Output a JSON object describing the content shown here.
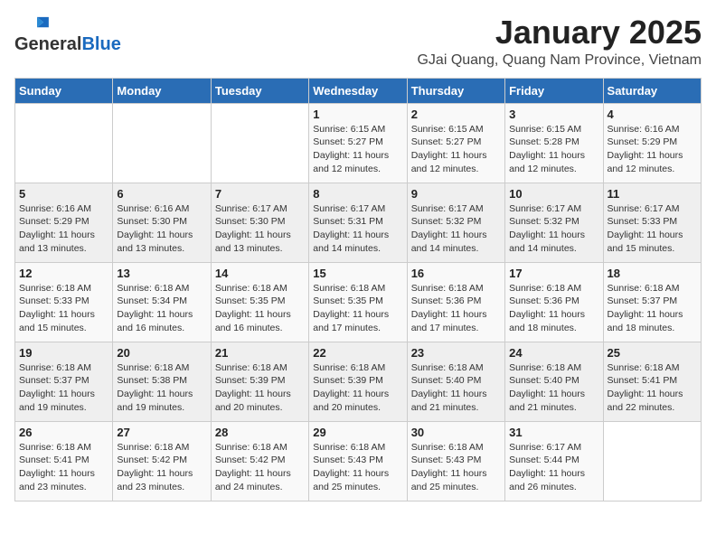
{
  "header": {
    "logo_general": "General",
    "logo_blue": "Blue",
    "month": "January 2025",
    "location": "GJai Quang, Quang Nam Province, Vietnam"
  },
  "weekdays": [
    "Sunday",
    "Monday",
    "Tuesday",
    "Wednesday",
    "Thursday",
    "Friday",
    "Saturday"
  ],
  "weeks": [
    [
      {
        "day": "",
        "info": ""
      },
      {
        "day": "",
        "info": ""
      },
      {
        "day": "",
        "info": ""
      },
      {
        "day": "1",
        "info": "Sunrise: 6:15 AM\nSunset: 5:27 PM\nDaylight: 11 hours and 12 minutes."
      },
      {
        "day": "2",
        "info": "Sunrise: 6:15 AM\nSunset: 5:27 PM\nDaylight: 11 hours and 12 minutes."
      },
      {
        "day": "3",
        "info": "Sunrise: 6:15 AM\nSunset: 5:28 PM\nDaylight: 11 hours and 12 minutes."
      },
      {
        "day": "4",
        "info": "Sunrise: 6:16 AM\nSunset: 5:29 PM\nDaylight: 11 hours and 12 minutes."
      }
    ],
    [
      {
        "day": "5",
        "info": "Sunrise: 6:16 AM\nSunset: 5:29 PM\nDaylight: 11 hours and 13 minutes."
      },
      {
        "day": "6",
        "info": "Sunrise: 6:16 AM\nSunset: 5:30 PM\nDaylight: 11 hours and 13 minutes."
      },
      {
        "day": "7",
        "info": "Sunrise: 6:17 AM\nSunset: 5:30 PM\nDaylight: 11 hours and 13 minutes."
      },
      {
        "day": "8",
        "info": "Sunrise: 6:17 AM\nSunset: 5:31 PM\nDaylight: 11 hours and 14 minutes."
      },
      {
        "day": "9",
        "info": "Sunrise: 6:17 AM\nSunset: 5:32 PM\nDaylight: 11 hours and 14 minutes."
      },
      {
        "day": "10",
        "info": "Sunrise: 6:17 AM\nSunset: 5:32 PM\nDaylight: 11 hours and 14 minutes."
      },
      {
        "day": "11",
        "info": "Sunrise: 6:17 AM\nSunset: 5:33 PM\nDaylight: 11 hours and 15 minutes."
      }
    ],
    [
      {
        "day": "12",
        "info": "Sunrise: 6:18 AM\nSunset: 5:33 PM\nDaylight: 11 hours and 15 minutes."
      },
      {
        "day": "13",
        "info": "Sunrise: 6:18 AM\nSunset: 5:34 PM\nDaylight: 11 hours and 16 minutes."
      },
      {
        "day": "14",
        "info": "Sunrise: 6:18 AM\nSunset: 5:35 PM\nDaylight: 11 hours and 16 minutes."
      },
      {
        "day": "15",
        "info": "Sunrise: 6:18 AM\nSunset: 5:35 PM\nDaylight: 11 hours and 17 minutes."
      },
      {
        "day": "16",
        "info": "Sunrise: 6:18 AM\nSunset: 5:36 PM\nDaylight: 11 hours and 17 minutes."
      },
      {
        "day": "17",
        "info": "Sunrise: 6:18 AM\nSunset: 5:36 PM\nDaylight: 11 hours and 18 minutes."
      },
      {
        "day": "18",
        "info": "Sunrise: 6:18 AM\nSunset: 5:37 PM\nDaylight: 11 hours and 18 minutes."
      }
    ],
    [
      {
        "day": "19",
        "info": "Sunrise: 6:18 AM\nSunset: 5:37 PM\nDaylight: 11 hours and 19 minutes."
      },
      {
        "day": "20",
        "info": "Sunrise: 6:18 AM\nSunset: 5:38 PM\nDaylight: 11 hours and 19 minutes."
      },
      {
        "day": "21",
        "info": "Sunrise: 6:18 AM\nSunset: 5:39 PM\nDaylight: 11 hours and 20 minutes."
      },
      {
        "day": "22",
        "info": "Sunrise: 6:18 AM\nSunset: 5:39 PM\nDaylight: 11 hours and 20 minutes."
      },
      {
        "day": "23",
        "info": "Sunrise: 6:18 AM\nSunset: 5:40 PM\nDaylight: 11 hours and 21 minutes."
      },
      {
        "day": "24",
        "info": "Sunrise: 6:18 AM\nSunset: 5:40 PM\nDaylight: 11 hours and 21 minutes."
      },
      {
        "day": "25",
        "info": "Sunrise: 6:18 AM\nSunset: 5:41 PM\nDaylight: 11 hours and 22 minutes."
      }
    ],
    [
      {
        "day": "26",
        "info": "Sunrise: 6:18 AM\nSunset: 5:41 PM\nDaylight: 11 hours and 23 minutes."
      },
      {
        "day": "27",
        "info": "Sunrise: 6:18 AM\nSunset: 5:42 PM\nDaylight: 11 hours and 23 minutes."
      },
      {
        "day": "28",
        "info": "Sunrise: 6:18 AM\nSunset: 5:42 PM\nDaylight: 11 hours and 24 minutes."
      },
      {
        "day": "29",
        "info": "Sunrise: 6:18 AM\nSunset: 5:43 PM\nDaylight: 11 hours and 25 minutes."
      },
      {
        "day": "30",
        "info": "Sunrise: 6:18 AM\nSunset: 5:43 PM\nDaylight: 11 hours and 25 minutes."
      },
      {
        "day": "31",
        "info": "Sunrise: 6:17 AM\nSunset: 5:44 PM\nDaylight: 11 hours and 26 minutes."
      },
      {
        "day": "",
        "info": ""
      }
    ]
  ]
}
